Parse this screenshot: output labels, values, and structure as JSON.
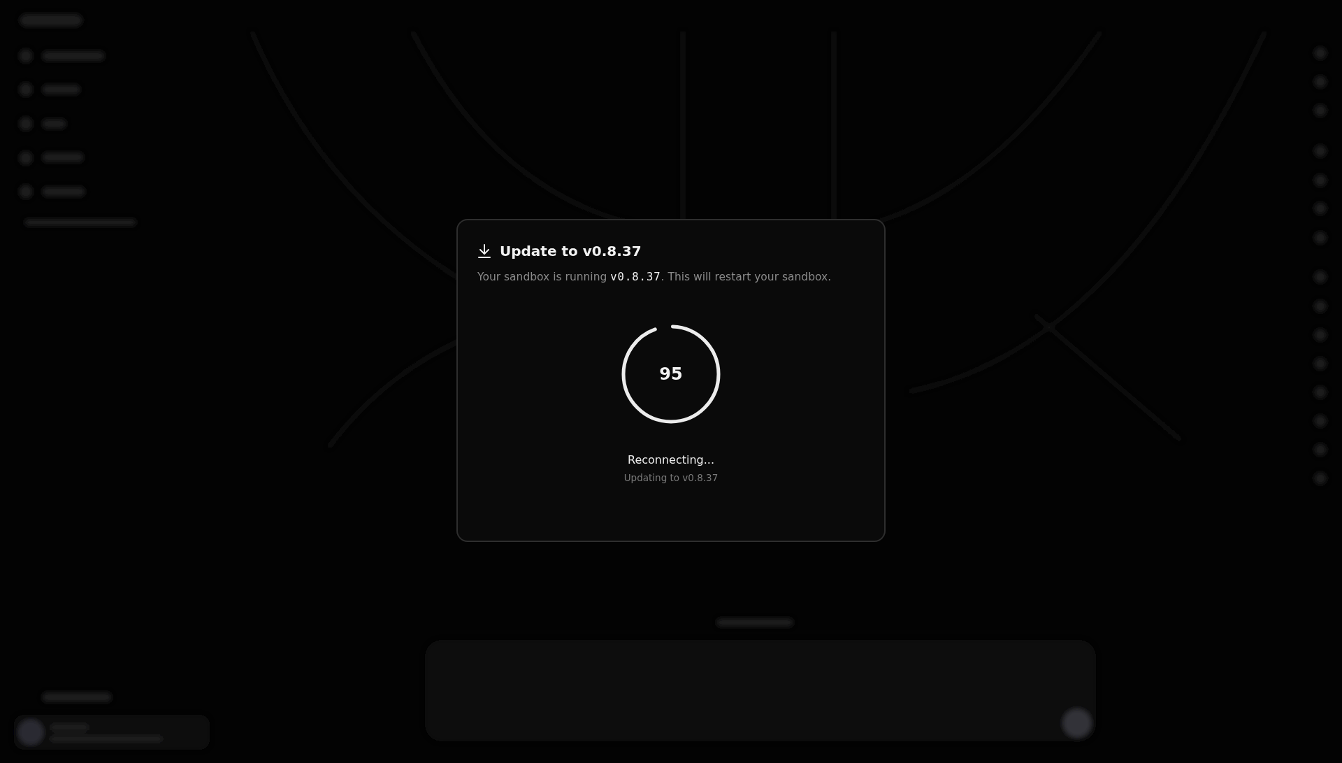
{
  "dialog": {
    "title": "Update to v0.8.37",
    "message": [
      {
        "kind": "text",
        "text": "Your sandbox is running "
      },
      {
        "kind": "code",
        "text": "v0.8.37"
      },
      {
        "kind": "text",
        "text": ". This will restart your sandbox."
      }
    ],
    "progress": {
      "level": 0.95,
      "reading": "95"
    },
    "status": "Reconnecting...",
    "detail": "Updating to v0.8.37"
  }
}
